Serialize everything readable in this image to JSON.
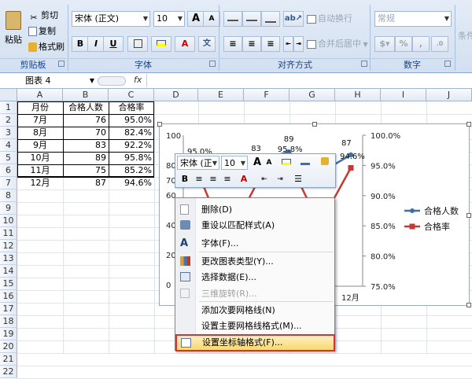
{
  "ribbon": {
    "clipboard": {
      "paste": "粘贴",
      "cut": "剪切",
      "copy": "复制",
      "format_painter": "格式刷",
      "group": "剪贴板"
    },
    "font": {
      "name": "宋体 (正文)",
      "size": "10",
      "bold": "B",
      "italic": "I",
      "underline": "U",
      "grow": "A",
      "shrink": "A",
      "group": "字体"
    },
    "alignment": {
      "wrap_text": "自动换行",
      "merge_center": "合并后居中",
      "group": "对齐方式"
    },
    "number": {
      "format": "常规",
      "percent": "%",
      "comma": ",",
      "group": "数字"
    },
    "styles": {
      "conditional": "条件格"
    }
  },
  "formula_bar": {
    "name_box": "图表 4",
    "fx": "fx",
    "value": ""
  },
  "grid": {
    "columns": [
      "A",
      "B",
      "C",
      "D",
      "E",
      "F",
      "G",
      "H",
      "I",
      "J"
    ],
    "rows": [
      "1",
      "2",
      "3",
      "4",
      "5",
      "6",
      "7",
      "8",
      "9",
      "10",
      "11",
      "12",
      "13",
      "14",
      "15",
      "16",
      "17",
      "18",
      "19",
      "20",
      "21",
      "22"
    ]
  },
  "table": {
    "headers": [
      "月份",
      "合格人数",
      "合格率"
    ],
    "rows": [
      [
        "7月",
        "76",
        "95.0%"
      ],
      [
        "8月",
        "70",
        "82.4%"
      ],
      [
        "9月",
        "83",
        "92.2%"
      ],
      [
        "10月",
        "89",
        "95.8%"
      ],
      [
        "11月",
        "75",
        "85.2%"
      ],
      [
        "12月",
        "87",
        "94.6%"
      ]
    ]
  },
  "chart_data": {
    "type": "line",
    "categories": [
      "7月",
      "8月",
      "9月",
      "10月",
      "11月",
      "12月"
    ],
    "series": [
      {
        "name": "合格人数",
        "values": [
          76,
          70,
          83,
          89,
          75,
          87
        ],
        "color": "#3f6fa8",
        "axis": "left"
      },
      {
        "name": "合格率",
        "values": [
          0.95,
          0.824,
          0.922,
          0.958,
          0.852,
          0.946
        ],
        "color": "#c23a36",
        "axis": "right"
      }
    ],
    "visible_data_labels": [
      "95.0%",
      "83",
      "89",
      "95.8%",
      "87",
      "94.6%"
    ],
    "visible_x_labels": [
      "12月"
    ],
    "y_left": {
      "ticks": [
        "100",
        "80",
        "70",
        "60",
        "40",
        "20",
        "0"
      ]
    },
    "y_right": {
      "ticks": [
        "100.0%",
        "95.0%",
        "90.0%",
        "85.0%",
        "80.0%",
        "75.0%"
      ],
      "range": [
        0.75,
        1.0
      ]
    },
    "legend": "right"
  },
  "mini_toolbar": {
    "font": "宋体 (正",
    "size": "10",
    "bold": "B",
    "grow": "A",
    "shrink": "A",
    "font_color": "A"
  },
  "context_menu": {
    "items": [
      {
        "label": "删除(D)",
        "icon": "delete-icon",
        "enabled": true
      },
      {
        "label": "重设以匹配样式(A)",
        "icon": "reset-style-icon",
        "enabled": true
      },
      {
        "label": "字体(F)...",
        "icon": "font-icon",
        "enabled": true
      },
      {
        "label": "更改图表类型(Y)...",
        "icon": "chart-type-icon",
        "enabled": true
      },
      {
        "label": "选择数据(E)...",
        "icon": "select-data-icon",
        "enabled": true
      },
      {
        "label": "三维旋转(R)...",
        "icon": "3d-rotate-icon",
        "enabled": false
      },
      {
        "label": "添加次要网格线(N)",
        "icon": "",
        "enabled": true
      },
      {
        "label": "设置主要网格线格式(M)...",
        "icon": "",
        "enabled": true
      },
      {
        "label": "设置坐标轴格式(F)...",
        "icon": "format-axis-icon",
        "enabled": true,
        "highlighted": true
      }
    ]
  }
}
